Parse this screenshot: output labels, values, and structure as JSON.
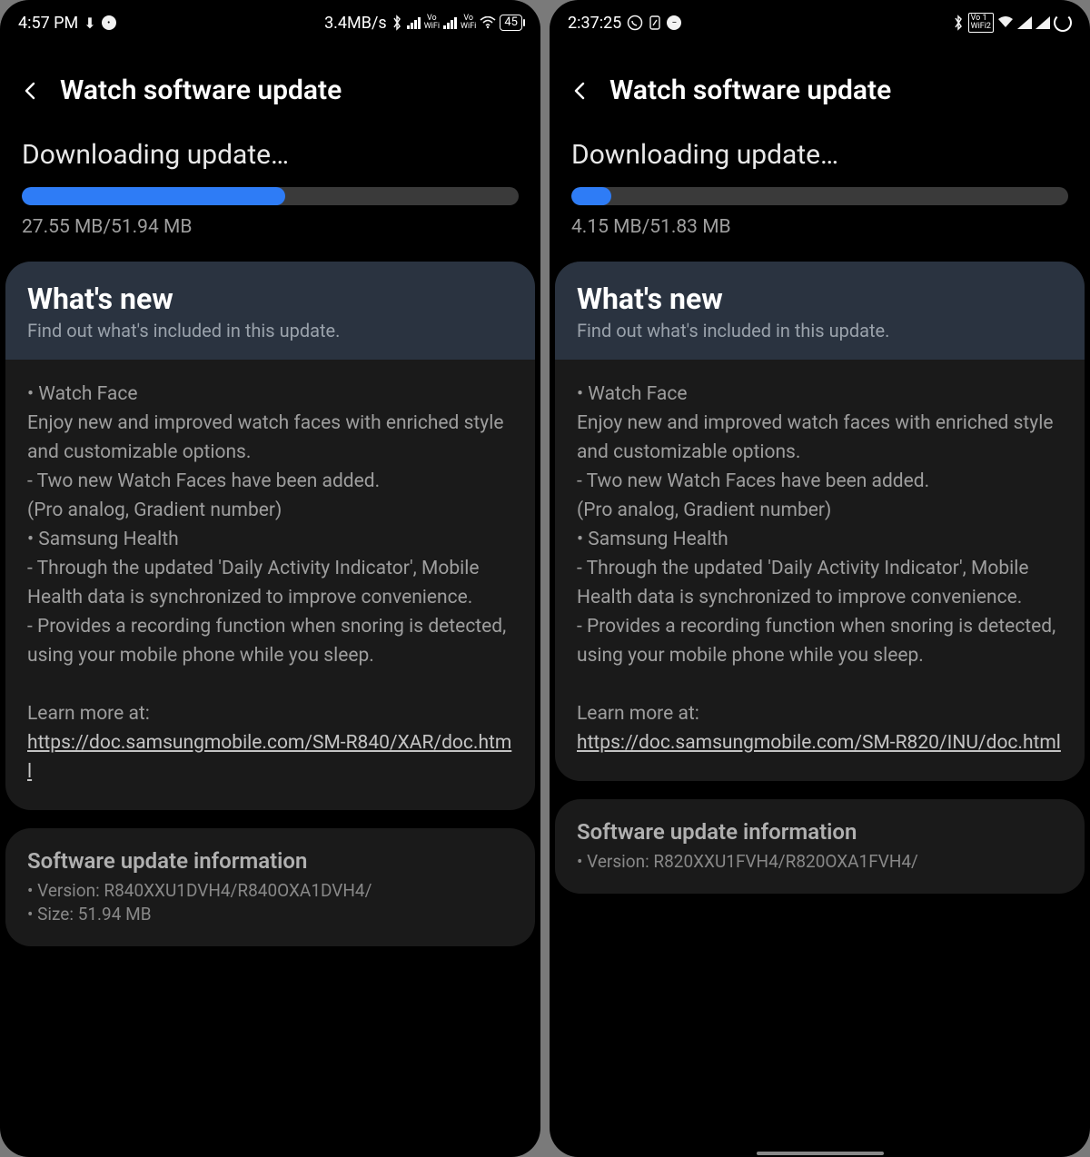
{
  "left": {
    "status": {
      "time": "4:57 PM",
      "speed": "3.4MB/s",
      "battery": "45"
    },
    "header": {
      "title": "Watch software update"
    },
    "download": {
      "title": "Downloading update…",
      "progress_pct": 53,
      "progress_label": "27.55 MB/51.94 MB"
    },
    "whatsnew": {
      "title": "What's new",
      "subtitle": "Find out what's included in this update.",
      "body_lines": [
        "• Watch Face",
        "Enjoy new and improved watch faces with enriched style and customizable options.",
        " - Two new Watch Faces have been added.",
        "   (Pro analog, Gradient number)",
        "• Samsung Health",
        " - Through the updated 'Daily Activity Indicator', Mobile Health data is synchronized to improve convenience.",
        " - Provides a recording function when snoring is detected, using your mobile phone while you sleep."
      ],
      "learn_label": "Learn more at:",
      "learn_url": "https://doc.samsungmobile.com/SM-R840/XAR/doc.html"
    },
    "info": {
      "title": "Software update information",
      "version_label": "• Version: R840XXU1DVH4/R840OXA1DVH4/",
      "size_label": "• Size: 51.94 MB"
    }
  },
  "right": {
    "status": {
      "time": "2:37:25"
    },
    "header": {
      "title": "Watch software update"
    },
    "download": {
      "title": "Downloading update…",
      "progress_pct": 8,
      "progress_label": "4.15 MB/51.83 MB"
    },
    "whatsnew": {
      "title": "What's new",
      "subtitle": "Find out what's included in this update.",
      "body_lines": [
        "• Watch Face",
        "Enjoy new and improved watch faces with enriched style and customizable options.",
        " - Two new Watch Faces have been added.",
        "   (Pro analog, Gradient number)",
        "• Samsung Health",
        " - Through the updated 'Daily Activity Indicator', Mobile Health data is synchronized to improve convenience.",
        " - Provides a recording function when snoring is detected, using your mobile phone while you sleep."
      ],
      "learn_label": "Learn more at:",
      "learn_url": "https://doc.samsungmobile.com/SM-R820/INU/doc.html"
    },
    "info": {
      "title": "Software update information",
      "version_label": "• Version: R820XXU1FVH4/R820OXA1FVH4/"
    }
  }
}
